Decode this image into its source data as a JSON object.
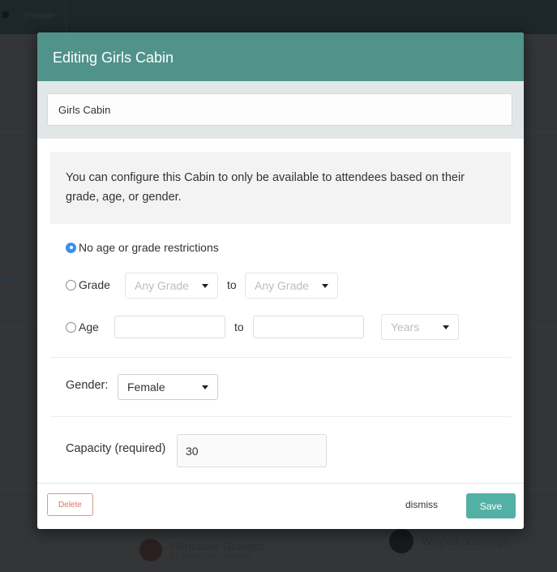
{
  "background": {
    "navbar": {
      "label": "People",
      "icon": "people-icon"
    },
    "people": [
      {
        "name": "Hermione Granger",
        "sub": "12 Years Old · Female"
      },
      {
        "name": "Waylon Jennings",
        "sub": ""
      }
    ]
  },
  "modal": {
    "title": "Editing Girls Cabin",
    "name_input": {
      "value": "Girls Cabin"
    },
    "info_text": "You can configure this Cabin to only be available to attendees based on their grade, age, or gender.",
    "restrictions": {
      "options": [
        {
          "label": "No age or grade restrictions",
          "checked": true
        },
        {
          "label": "Grade",
          "checked": false
        },
        {
          "label": "Age",
          "checked": false
        }
      ],
      "grade_from": {
        "value": "Any Grade"
      },
      "grade_to": {
        "value": "Any Grade"
      },
      "to_label": "to",
      "age_from": {
        "value": ""
      },
      "age_to": {
        "value": ""
      },
      "age_unit": {
        "value": "Years"
      }
    },
    "gender": {
      "label": "Gender:",
      "value": "Female"
    },
    "capacity": {
      "label": "Capacity (required)",
      "value": "30"
    },
    "footer": {
      "delete_label": "Delete",
      "dismiss_label": "dismiss",
      "save_label": "Save"
    }
  },
  "colors": {
    "header": "#4f938a",
    "save": "#52b0a4",
    "delete": "#d0776a",
    "radio_checked": "#3b8ef0"
  }
}
